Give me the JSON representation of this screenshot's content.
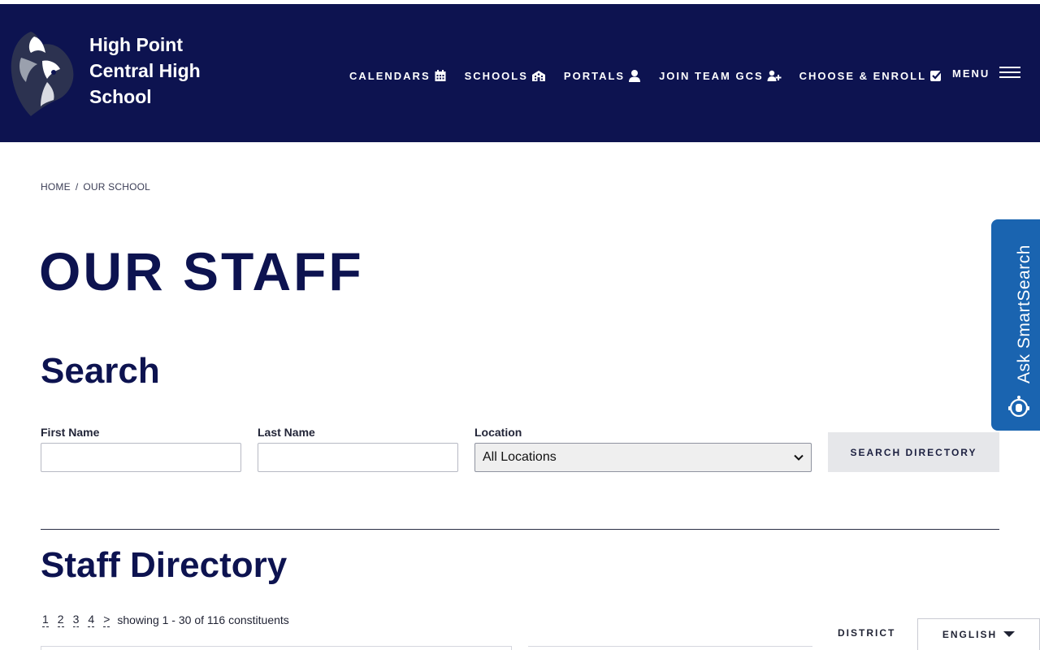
{
  "header": {
    "school_name_line1": "High Point",
    "school_name_line2": "Central High",
    "school_name_line3": "School",
    "nav": [
      {
        "label": "CALENDARS",
        "icon": "calendar-icon"
      },
      {
        "label": "SCHOOLS",
        "icon": "school-building-icon"
      },
      {
        "label": "PORTALS",
        "icon": "user-icon"
      },
      {
        "label": "JOIN TEAM GCS",
        "icon": "add-user-icon"
      },
      {
        "label": "CHOOSE & ENROLL",
        "icon": "checkbox-icon"
      }
    ],
    "menu_label": "MENU",
    "background": "#0d1350"
  },
  "breadcrumb": {
    "home": "HOME",
    "separator": "/",
    "current": "OUR SCHOOL"
  },
  "page_title": "OUR STAFF",
  "search": {
    "heading": "Search",
    "first_name_label": "First Name",
    "first_name_value": "",
    "last_name_label": "Last Name",
    "last_name_value": "",
    "location_label": "Location",
    "location_selected": "All Locations",
    "button_label": "SEARCH DIRECTORY"
  },
  "directory": {
    "heading": "Staff Directory",
    "pages": [
      "1",
      "2",
      "3",
      "4"
    ],
    "next": ">",
    "showing": "showing 1 - 30 of 116 constituents"
  },
  "footer_bar": {
    "district_label": "DISTRICT",
    "language": "ENGLISH"
  },
  "smart_search": {
    "label": "Ask SmartSearch",
    "color": "#1a64b0"
  }
}
